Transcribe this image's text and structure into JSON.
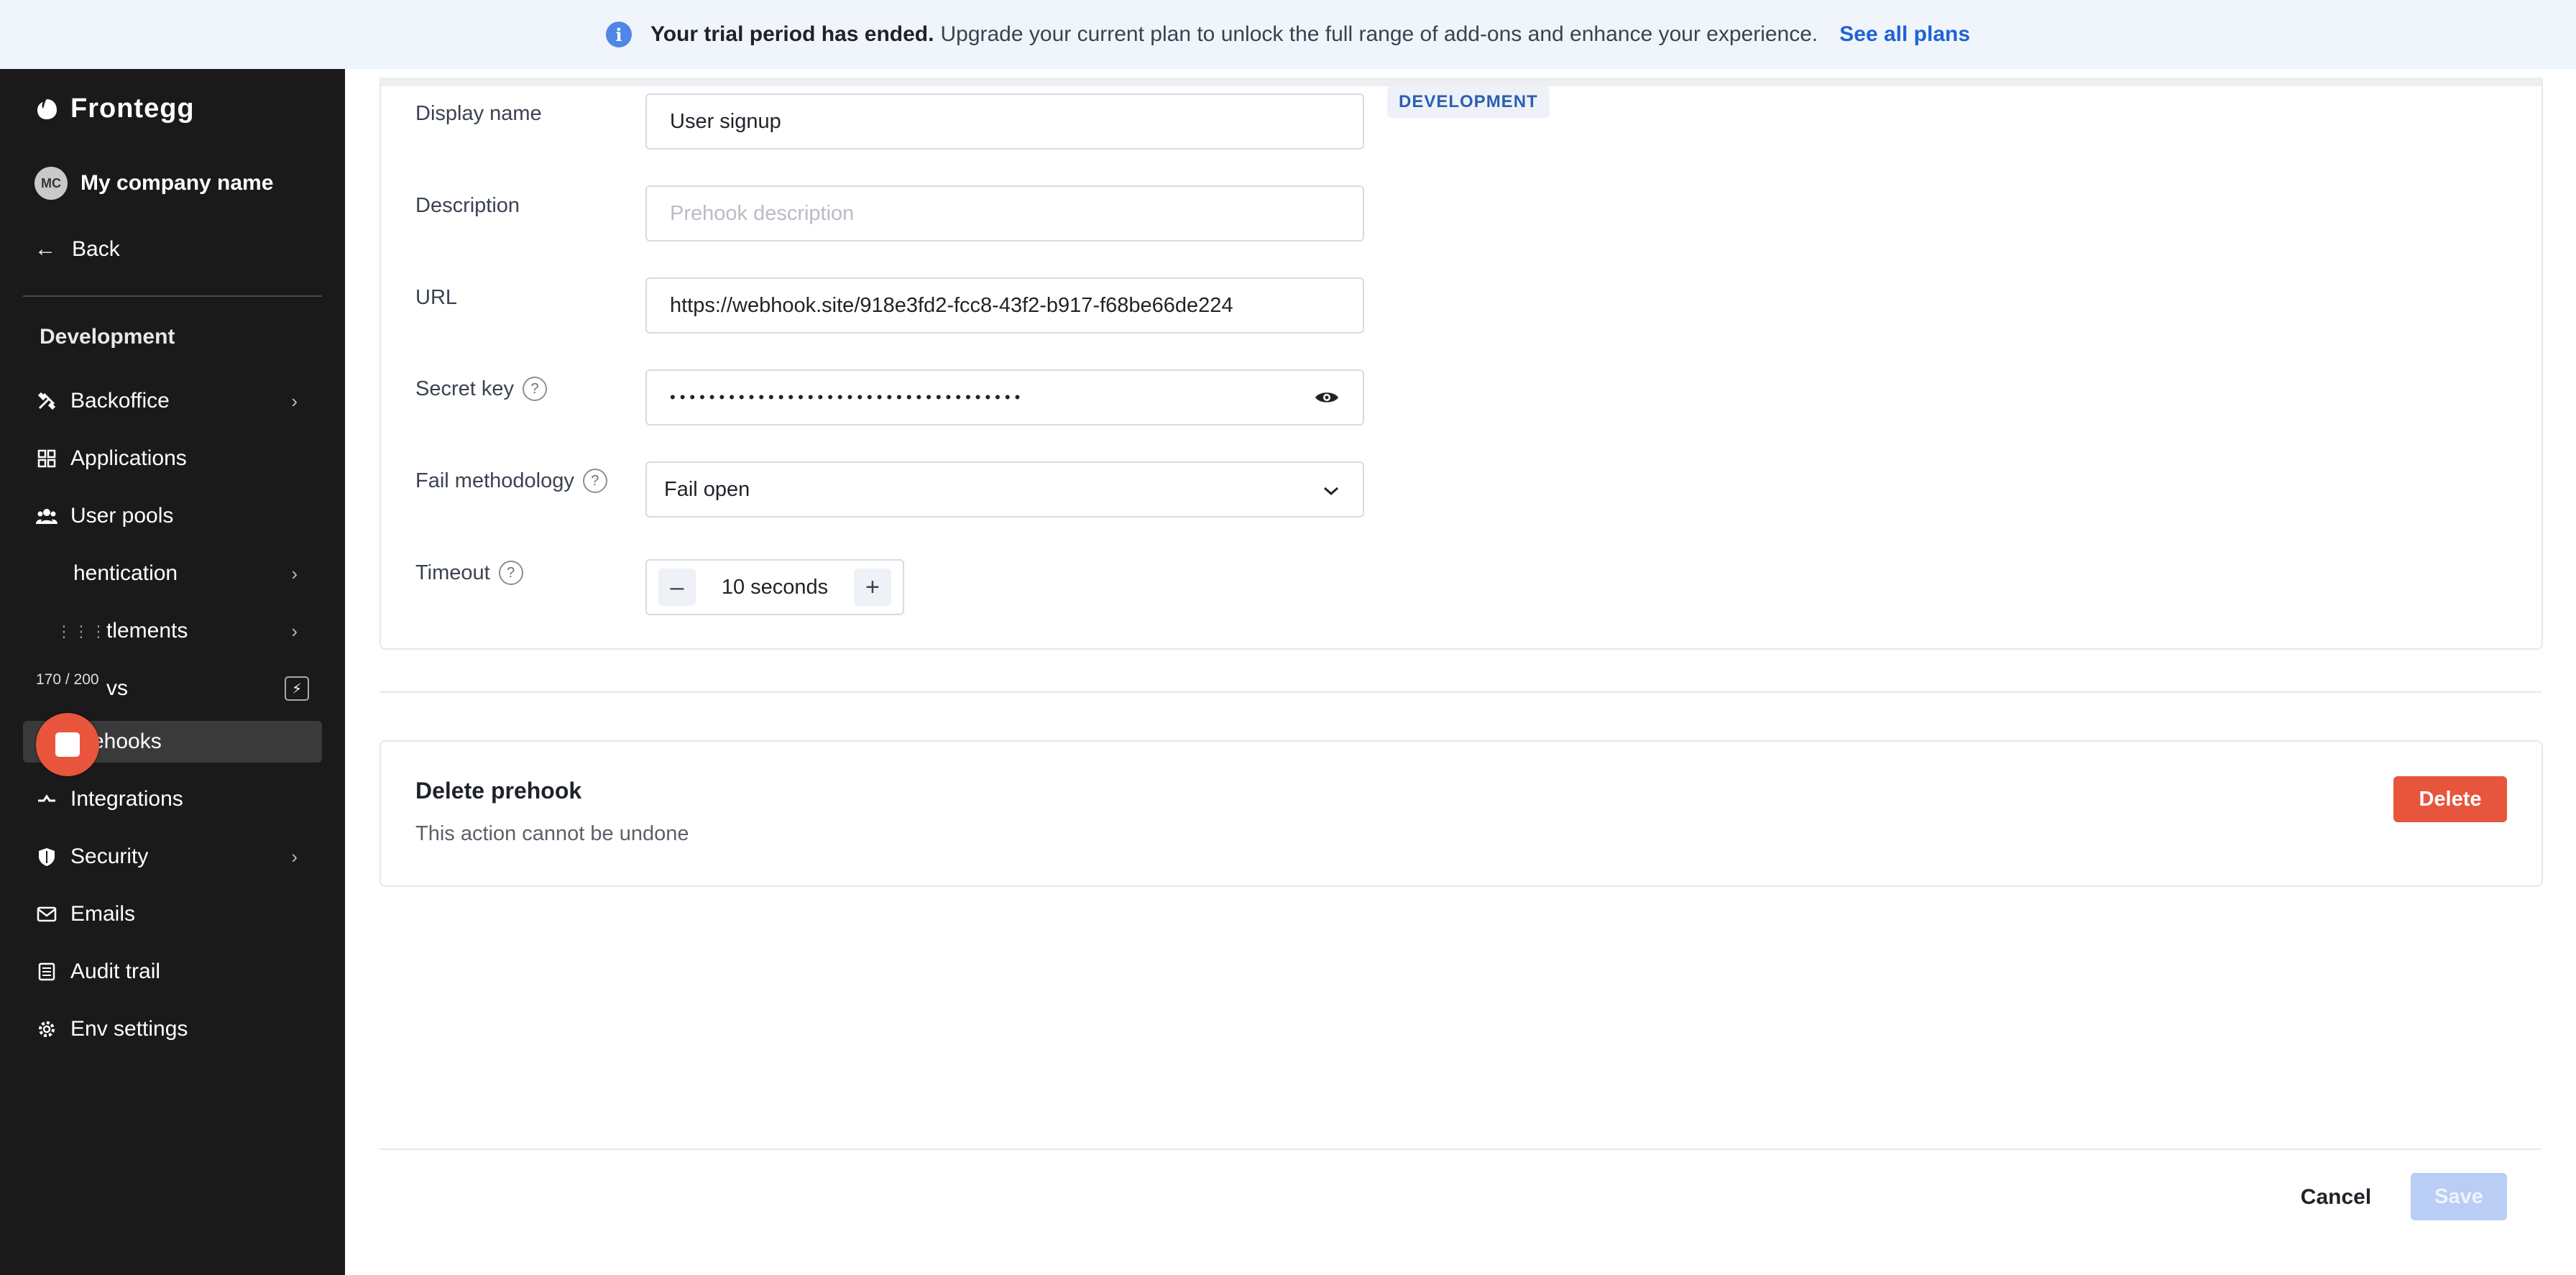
{
  "banner": {
    "bold": "Your trial period has ended.",
    "text": "Upgrade your current plan to unlock the full range of add-ons and enhance your experience.",
    "link": "See all plans"
  },
  "sidebar": {
    "logo": "Frontegg",
    "company_initials": "MC",
    "company": "My company name",
    "back": "Back",
    "section": "Development",
    "items": [
      {
        "label": "Backoffice",
        "icon": "tools-icon",
        "chevron": true
      },
      {
        "label": "Applications",
        "icon": "grid-icon",
        "chevron": false
      },
      {
        "label": "User pools",
        "icon": "users-icon",
        "chevron": false
      },
      {
        "label": "hentication",
        "icon": "lock-icon",
        "chevron": true
      },
      {
        "label": "tlements",
        "icon": "key-icon",
        "chevron": true
      },
      {
        "label": "vs",
        "icon": "flow-icon",
        "chevron": false
      },
      {
        "label": "Prehooks",
        "icon": "prehook-icon",
        "chevron": false,
        "active": true
      },
      {
        "label": "Integrations",
        "icon": "plug-icon",
        "chevron": false
      },
      {
        "label": "Security",
        "icon": "shield-icon",
        "chevron": true
      },
      {
        "label": "Emails",
        "icon": "mail-icon",
        "chevron": false
      },
      {
        "label": "Audit trail",
        "icon": "list-icon",
        "chevron": false
      },
      {
        "label": "Env settings",
        "icon": "gear-icon",
        "chevron": false
      }
    ]
  },
  "recorder": {
    "count": "170 / 200"
  },
  "form": {
    "badge": "DEVELOPMENT",
    "display_name_label": "Display name",
    "display_name_value": "User signup",
    "description_label": "Description",
    "description_placeholder": "Prehook description",
    "url_label": "URL",
    "url_value": "https://webhook.site/918e3fd2-fcc8-43f2-b917-f68be66de224",
    "secret_label": "Secret key",
    "secret_value": "••••••••••••••••••••••••••••••••••••",
    "fail_label": "Fail methodology",
    "fail_value": "Fail open",
    "timeout_label": "Timeout",
    "timeout_value": "10 seconds"
  },
  "delete_section": {
    "title": "Delete prehook",
    "subtitle": "This action cannot be undone",
    "button": "Delete"
  },
  "footer": {
    "cancel": "Cancel",
    "save": "Save"
  },
  "colors": {
    "accent": "#1e63d6",
    "danger": "#e8553d",
    "sidebar_bg": "#1a1a1a"
  }
}
